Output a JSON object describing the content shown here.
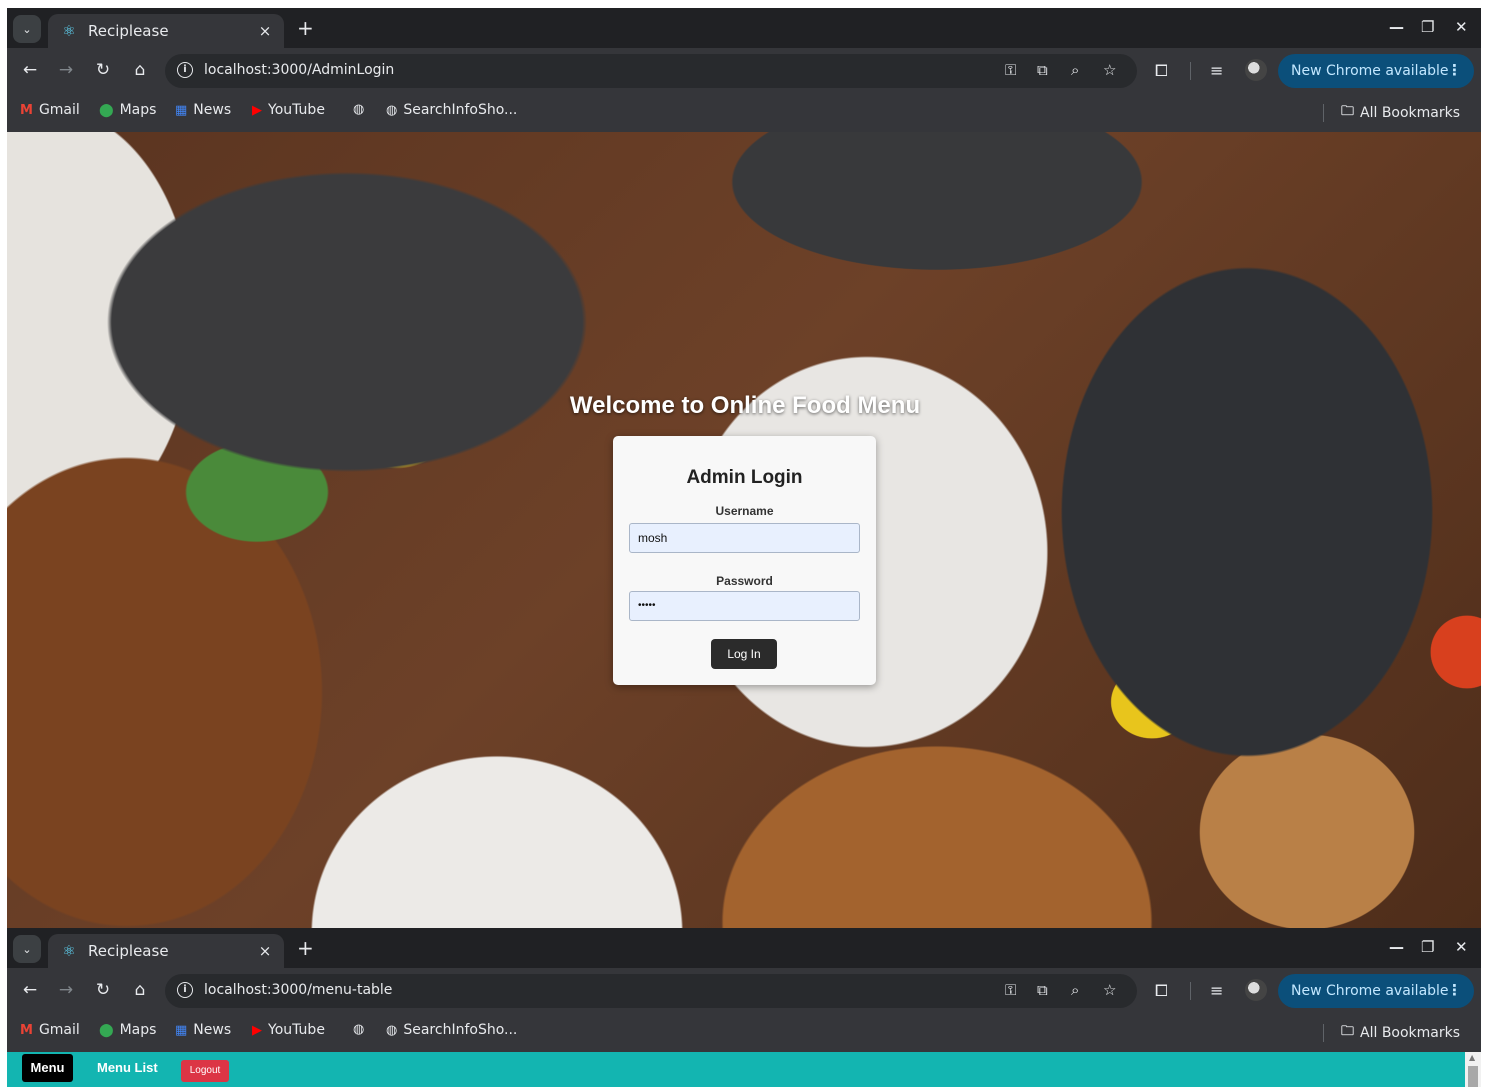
{
  "windows": [
    {
      "tab": {
        "title": "Reciplease",
        "close": "×",
        "new_tab": "+"
      },
      "url": "localhost:3000/AdminLogin",
      "chrome_update": "New Chrome available",
      "bookmarks": [
        "Gmail",
        "Maps",
        "News",
        "YouTube",
        "SearchInfoSho...",
        "All Bookmarks"
      ]
    },
    {
      "tab": {
        "title": "Reciplease",
        "close": "×",
        "new_tab": "+"
      },
      "url": "localhost:3000/menu-table",
      "chrome_update": "New Chrome available",
      "bookmarks": [
        "Gmail",
        "Maps",
        "News",
        "YouTube",
        "SearchInfoSho...",
        "All Bookmarks"
      ]
    }
  ],
  "page": {
    "welcome": "Welcome to Online Food Menu",
    "login": {
      "title": "Admin Login",
      "username_label": "Username",
      "username_value": "mosh",
      "password_label": "Password",
      "password_value": "•••••",
      "button": "Log In"
    }
  },
  "app_nav": {
    "menu": "Menu",
    "menu_list": "Menu List",
    "logout": "Logout"
  },
  "colors": {
    "appbar": "#13b5b1",
    "logout": "#dc3545",
    "chrome_update_bg": "#0b4f7a"
  }
}
